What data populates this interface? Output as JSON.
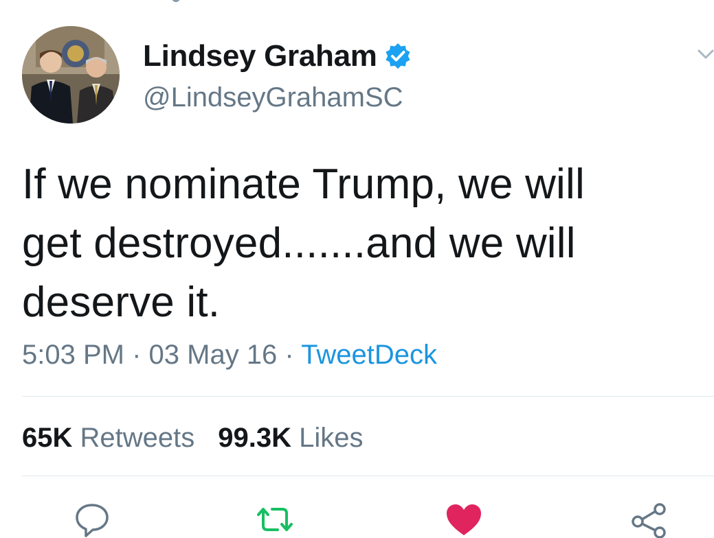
{
  "tweet": {
    "display_name": "Lindsey Graham",
    "handle": "@LindseyGrahamSC",
    "verified": true,
    "text": "If we nominate Trump, we will\nget destroyed.......and we will\ndeserve it.",
    "time": "5:03 PM",
    "date": "03 May 16",
    "separator": " · ",
    "source": "TweetDeck"
  },
  "stats": {
    "retweets_count": "65K",
    "retweets_label": "Retweets",
    "likes_count": "99.3K",
    "likes_label": "Likes"
  },
  "actions": [
    {
      "name": "reply",
      "icon": "speech-bubble-icon"
    },
    {
      "name": "retweet",
      "icon": "retweet-icon",
      "color": "#17bf63"
    },
    {
      "name": "like",
      "icon": "heart-icon",
      "color": "#e0245e",
      "active": true
    },
    {
      "name": "share",
      "icon": "share-icon"
    }
  ],
  "colors": {
    "text": "#14171a",
    "secondary": "#657786",
    "link": "#1b95e0",
    "verified": "#1da1f2",
    "retweet": "#17bf63",
    "like": "#e0245e",
    "divider": "#e1e8ed"
  }
}
